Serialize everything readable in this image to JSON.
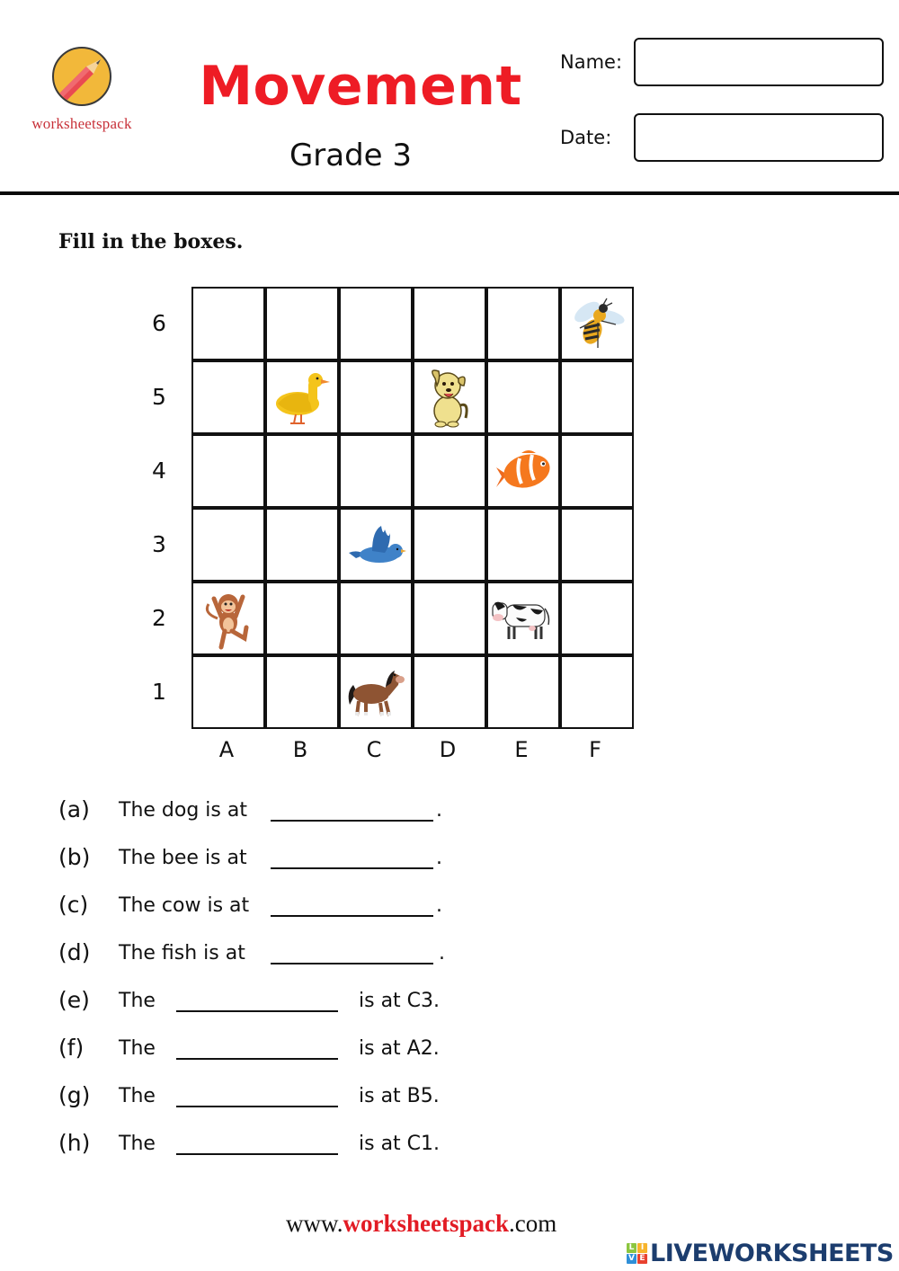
{
  "header": {
    "logo_text": "worksheetspack",
    "title": "Movement",
    "subtitle": "Grade 3",
    "name_label": "Name:",
    "date_label": "Date:",
    "name_value": "",
    "date_value": ""
  },
  "instruction": "Fill in the boxes.",
  "grid": {
    "columns": [
      "A",
      "B",
      "C",
      "D",
      "E",
      "F"
    ],
    "rows": [
      "6",
      "5",
      "4",
      "3",
      "2",
      "1"
    ],
    "animals": [
      {
        "name": "bee",
        "cell": "F6"
      },
      {
        "name": "duck",
        "cell": "B5"
      },
      {
        "name": "dog",
        "cell": "D5"
      },
      {
        "name": "fish",
        "cell": "E4"
      },
      {
        "name": "bird",
        "cell": "C3"
      },
      {
        "name": "monkey",
        "cell": "A2"
      },
      {
        "name": "cow",
        "cell": "E2"
      },
      {
        "name": "horse",
        "cell": "C1"
      }
    ]
  },
  "questions": [
    {
      "letter": "(a)",
      "prefix": "The dog is at",
      "suffix": ".",
      "answer": ""
    },
    {
      "letter": "(b)",
      "prefix": "The bee is at",
      "suffix": ".",
      "answer": ""
    },
    {
      "letter": "(c)",
      "prefix": "The cow is at",
      "suffix": ".",
      "answer": ""
    },
    {
      "letter": "(d)",
      "prefix": "The fish is at",
      "suffix": ".",
      "answer": ""
    },
    {
      "letter": "(e)",
      "prefix": "The",
      "suffix": "is at C3.",
      "answer": ""
    },
    {
      "letter": "(f)",
      "prefix": "The",
      "suffix": "is at A2.",
      "answer": ""
    },
    {
      "letter": "(g)",
      "prefix": "The",
      "suffix": "is at B5.",
      "answer": ""
    },
    {
      "letter": "(h)",
      "prefix": "The",
      "suffix": "is at C1.",
      "answer": ""
    }
  ],
  "footer": {
    "url_prefix": "www.",
    "url_brand": "worksheetspack",
    "url_suffix": ".com",
    "platform_badge": [
      "L",
      "I",
      "V",
      "E"
    ],
    "platform_name": "LIVEWORKSHEETS"
  },
  "colors": {
    "title": "#ee1c25",
    "logo_text": "#c8323a",
    "brand_red": "#e21b24",
    "platform_blue": "#1c3d6e",
    "badge": [
      "#8cc63f",
      "#f7b42c",
      "#2f8fd8",
      "#e8412f"
    ]
  }
}
